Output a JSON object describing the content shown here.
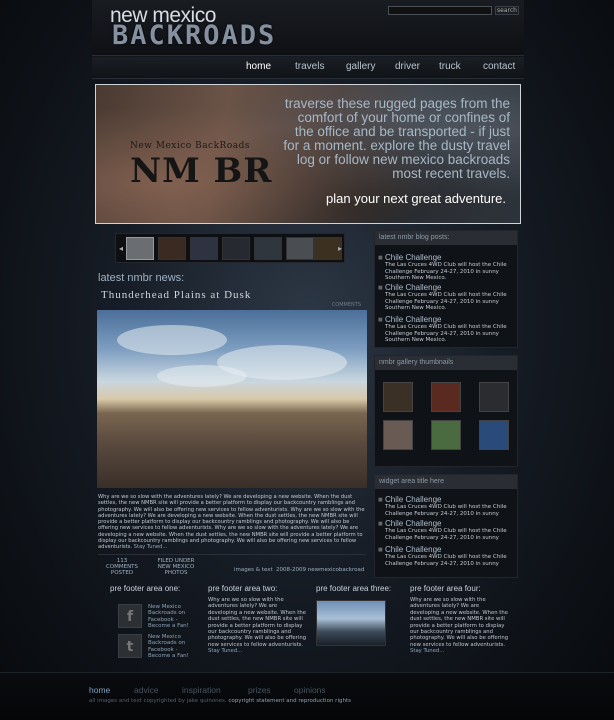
{
  "header": {
    "logo_top": "new mexico",
    "logo_bottom": "BACKROADS",
    "search_placeholder": "",
    "search_button": "search"
  },
  "nav": {
    "items": [
      "home",
      "travels",
      "gallery",
      "driver",
      "truck",
      "contact"
    ],
    "active": "home"
  },
  "hero": {
    "badge_small": "New Mexico BackRoads",
    "badge_big": "NM BR",
    "tagline": "traverse these rugged pages from the comfort of your home or confines of the office and be transported - if just for a moment. explore the dusty travel log or follow new mexico backroads most recent travels.",
    "cta": "plan your next great adventure."
  },
  "gallery_strip": {
    "prev": "◂",
    "next": "▸"
  },
  "news": {
    "heading": "latest nmbr news:",
    "post_title": "Thunderhead Plains at Dusk",
    "post_meta": "COMMENTS",
    "post_body": "Why are we so slow with the adventures lately? We are developing a new website. When the dust settles, the new NMBR site will provide a better platform to display our backcountry ramblings and photography. We will also be offering new services to fellow adventurists.  Why are we so slow with the adventures lately? We are developing a new website. When the dust settles, the new NMBR site will provide a better platform to display our backcountry ramblings and photography. We will also be offering new services to fellow adventurists.  Why are we so slow with the adventures lately? We are developing a new website. When the dust settles, the new NMBR site will provide a better platform to display our backcountry ramblings and photography. We will also be offering new services to fellow adventurists.",
    "stay_tuned": "Stay Tuned...",
    "comments_count": "113",
    "comments_label": "COMMENTS POSTED",
    "filed_label": "FILED UNDER",
    "filed_value": "NEW MEXICO PHOTOS",
    "credit": "images & text",
    "credit_year": "2008-2009 newmexicobackroad"
  },
  "sidebar": {
    "blog_title": "latest nmbr blog posts:",
    "blog_posts": [
      {
        "title": "Chile Challenge",
        "text": "The Las Cruces 4WD Club will host the Chile Challenge February 24-27, 2010 in sunny Southern New Mexico."
      },
      {
        "title": "Chile Challenge",
        "text": "The Las Cruces 4WD Club will host the Chile Challenge February 24-27, 2010 in sunny Southern New Mexico."
      },
      {
        "title": "Chile Challenge",
        "text": "The Las Cruces 4WD Club will host the Chile Challenge February 24-27, 2010 in sunny Southern New Mexico."
      }
    ],
    "gallery_title": "nmbr gallery thumbnails",
    "widget_title": "widget area title here",
    "widget_posts": [
      {
        "title": "Chile Challenge",
        "text": "The Las Cruces 4WD Club will host the Chile Challenge February 24-27, 2010 in sunny"
      },
      {
        "title": "Chile Challenge",
        "text": "The Las Cruces 4WD Club will host the Chile Challenge February 24-27, 2010 in sunny"
      },
      {
        "title": "Chile Challenge",
        "text": "The Las Cruces 4WD Club will host the Chile Challenge February 24-27, 2010 in sunny"
      }
    ]
  },
  "prefooter": {
    "one_title": "pre footer area one:",
    "fb1": "New Mexico Backroads on Facebook - Become a Fan!",
    "fb2": "New Mexico Backroads on Facebook - Become a Fan!",
    "two_title": "pre footer area two:",
    "two_text": "Why are we so slow with the adventures lately? We are developing a new website. When the dust settles, the new NMBR site will provide a better platform to display our backcountry ramblings and photography. We will also be offering new services to fellow adventurists.",
    "two_stay": "Stay Tuned...",
    "three_title": "pre footer area three:",
    "four_title": "pre footer area four:",
    "four_text": "Why are we so slow with the adventures lately? We are developing a new website. When the dust settles, the new NMBR site will provide a better platform to display our backcountry ramblings and photography. We will also be offering new services to fellow adventurists.",
    "four_stay": "Stay Tuned..."
  },
  "footer": {
    "links": [
      "home",
      "advice",
      "inspiration",
      "prizes",
      "opinions"
    ],
    "copyright": "all images and text copyrighted by jake quinones.",
    "copyright_link": "copyright statement and reproduction rights"
  }
}
